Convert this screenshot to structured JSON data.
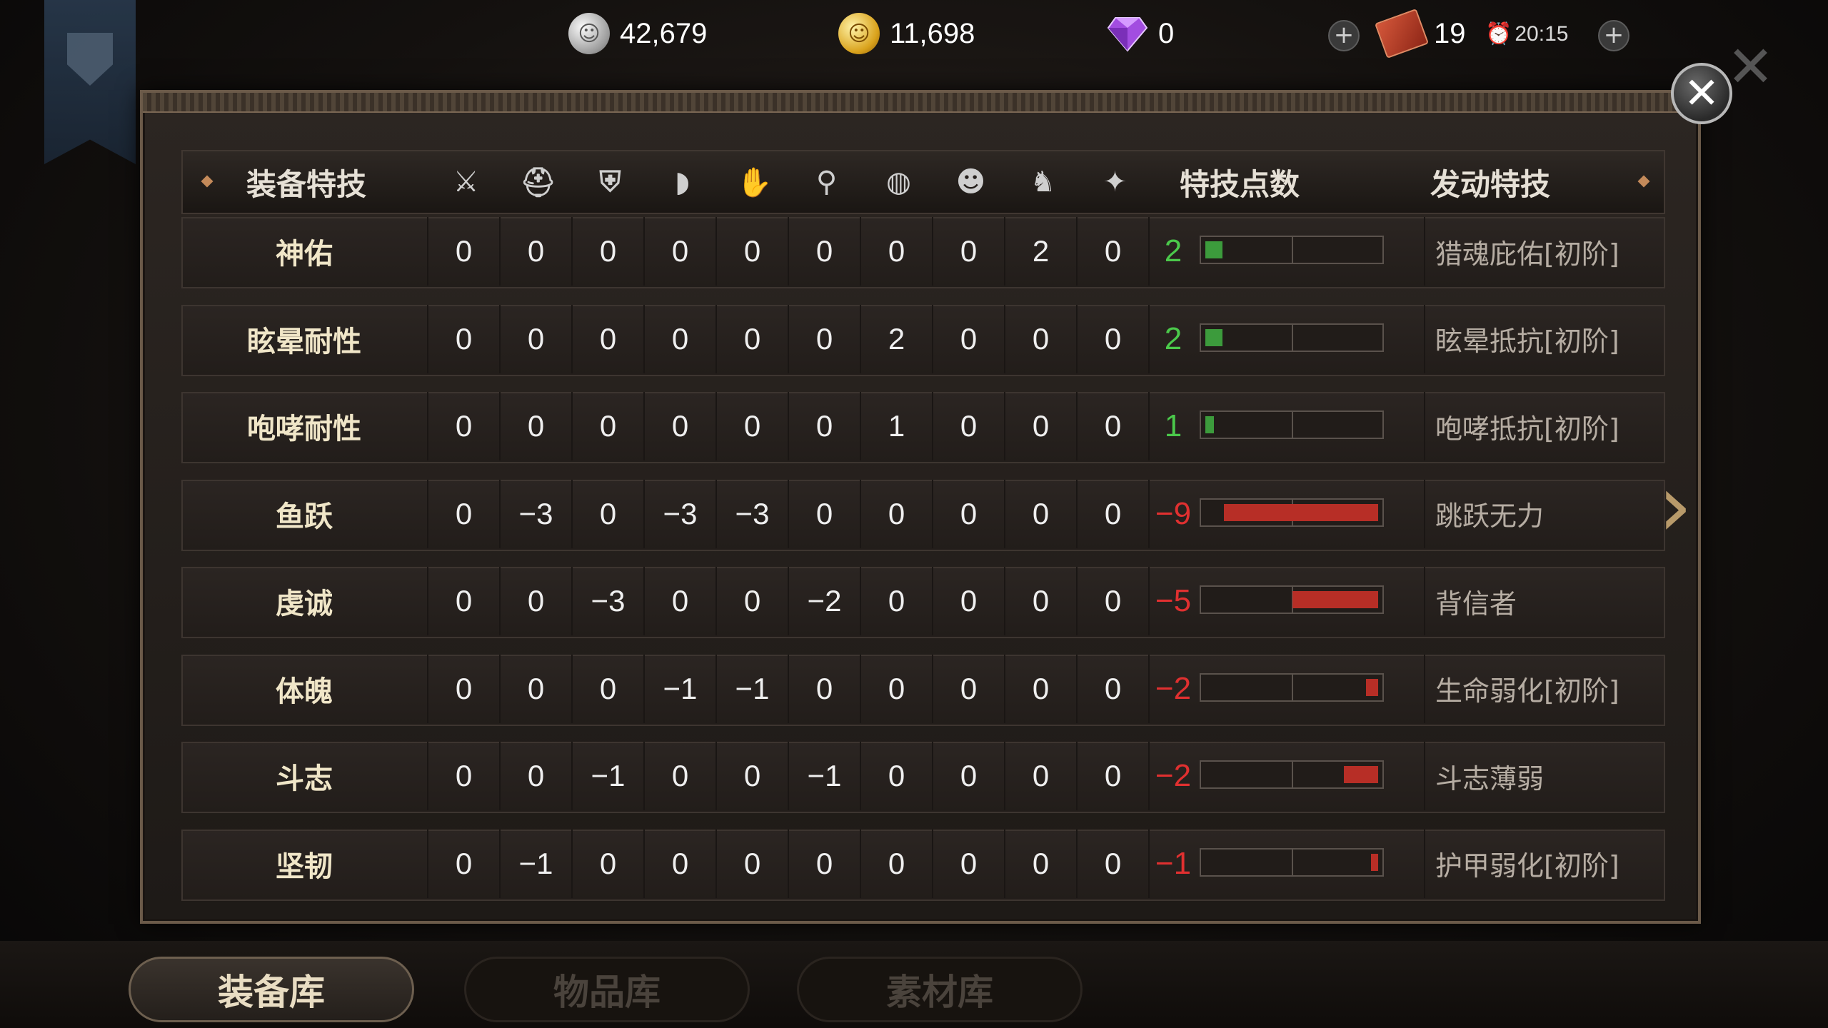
{
  "currency": {
    "silver": "42,679",
    "gold": "11,698",
    "diamond": "0",
    "tickets": "19",
    "timer": "20:15"
  },
  "table": {
    "headers": {
      "name": "装备特技",
      "points": "特技点数",
      "activated": "发动特技"
    },
    "slot_icons": [
      "sword-icon",
      "helmet-icon",
      "armor-icon",
      "shoulder-icon",
      "gauntlet-icon",
      "boots-icon",
      "ring-icon",
      "mask-icon",
      "horse-icon",
      "bird-icon"
    ],
    "slot_glyphs": [
      "⚔",
      "⛑",
      "⛨",
      "◗",
      "✋",
      "⚲",
      "◍",
      "☻",
      "♞",
      "✦"
    ],
    "rows": [
      {
        "name": "神佑",
        "vals": [
          "0",
          "0",
          "0",
          "0",
          "0",
          "0",
          "0",
          "0",
          "2",
          "0"
        ],
        "points": "2",
        "sign": "pos",
        "fill": 0.1,
        "skill": "猎魂庇佑[初阶]"
      },
      {
        "name": "眩晕耐性",
        "vals": [
          "0",
          "0",
          "0",
          "0",
          "0",
          "0",
          "2",
          "0",
          "0",
          "0"
        ],
        "points": "2",
        "sign": "pos",
        "fill": 0.1,
        "skill": "眩晕抵抗[初阶]"
      },
      {
        "name": "咆哮耐性",
        "vals": [
          "0",
          "0",
          "0",
          "0",
          "0",
          "0",
          "1",
          "0",
          "0",
          "0"
        ],
        "points": "1",
        "sign": "pos",
        "fill": 0.05,
        "skill": "咆哮抵抗[初阶]"
      },
      {
        "name": "鱼跃",
        "vals": [
          "0",
          "−3",
          "0",
          "−3",
          "−3",
          "0",
          "0",
          "0",
          "0",
          "0"
        ],
        "points": "−9",
        "sign": "neg",
        "fill": 0.9,
        "skill": "跳跃无力"
      },
      {
        "name": "虔诚",
        "vals": [
          "0",
          "0",
          "−3",
          "0",
          "0",
          "−2",
          "0",
          "0",
          "0",
          "0"
        ],
        "points": "−5",
        "sign": "neg",
        "fill": 0.5,
        "skill": "背信者"
      },
      {
        "name": "体魄",
        "vals": [
          "0",
          "0",
          "0",
          "−1",
          "−1",
          "0",
          "0",
          "0",
          "0",
          "0"
        ],
        "points": "−2",
        "sign": "neg",
        "fill": 0.07,
        "skill": "生命弱化[初阶]"
      },
      {
        "name": "斗志",
        "vals": [
          "0",
          "0",
          "−1",
          "0",
          "0",
          "−1",
          "0",
          "0",
          "0",
          "0"
        ],
        "points": "−2",
        "sign": "neg",
        "fill": 0.2,
        "skill": "斗志薄弱"
      },
      {
        "name": "坚韧",
        "vals": [
          "0",
          "−1",
          "0",
          "0",
          "0",
          "0",
          "0",
          "0",
          "0",
          "0"
        ],
        "points": "−1",
        "sign": "neg",
        "fill": 0.04,
        "skill": "护甲弱化[初阶]"
      }
    ]
  },
  "tabs": [
    {
      "label": "装备库",
      "active": true
    },
    {
      "label": "物品库",
      "active": false
    },
    {
      "label": "素材库",
      "active": false
    }
  ],
  "colors": {
    "positive": "#4bc94b",
    "negative": "#e03030"
  }
}
